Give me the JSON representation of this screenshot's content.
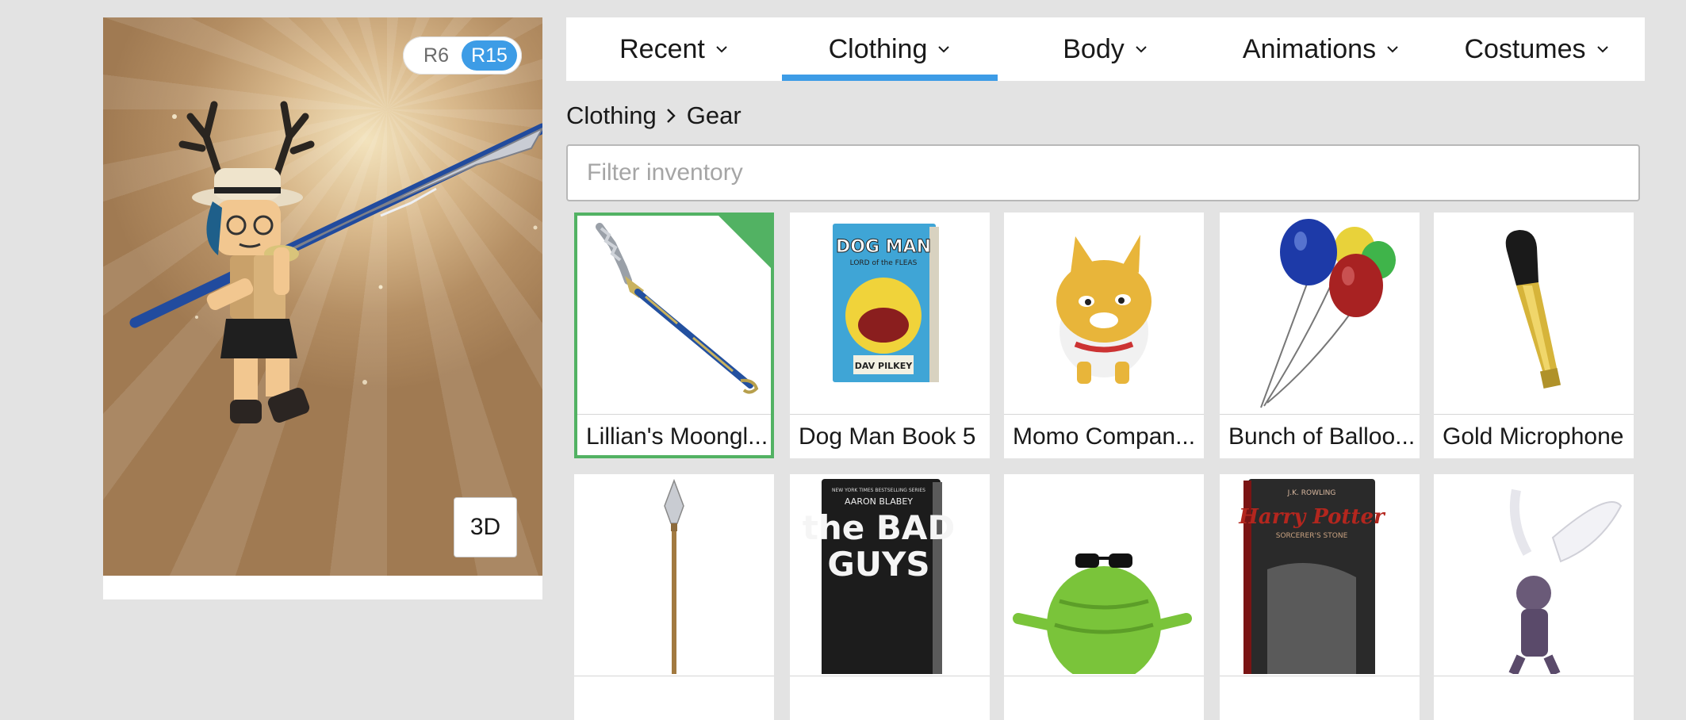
{
  "avatar": {
    "rig_options": [
      "R6",
      "R15"
    ],
    "selected_rig": "R15",
    "view_button_label": "3D"
  },
  "tabs": [
    {
      "label": "Recent",
      "active": false
    },
    {
      "label": "Clothing",
      "active": true
    },
    {
      "label": "Body",
      "active": false
    },
    {
      "label": "Animations",
      "active": false
    },
    {
      "label": "Costumes",
      "active": false
    }
  ],
  "breadcrumb": {
    "parent": "Clothing",
    "current": "Gear"
  },
  "filter": {
    "placeholder": "Filter inventory",
    "value": ""
  },
  "items": [
    {
      "name": "Lillian's Moongl...",
      "selected": true
    },
    {
      "name": "Dog Man Book 5",
      "selected": false
    },
    {
      "name": "Momo Compan...",
      "selected": false
    },
    {
      "name": "Bunch of Balloo...",
      "selected": false
    },
    {
      "name": "Gold Microphone",
      "selected": false
    },
    {
      "name": "",
      "selected": false
    },
    {
      "name": "",
      "selected": false
    },
    {
      "name": "",
      "selected": false
    },
    {
      "name": "",
      "selected": false
    },
    {
      "name": "",
      "selected": false
    }
  ],
  "book_covers": {
    "dog_man": {
      "title_line1": "DOG MAN",
      "subtitle": "LORD of the FLEAS",
      "author": "DAV PILKEY"
    },
    "bad_guys": {
      "series_banner": "NEW YORK TIMES BESTSELLING SERIES",
      "author": "AARON BLABEY",
      "title_line1": "the BAD",
      "title_line2": "GUYS"
    },
    "harry_potter": {
      "author": "J.K. ROWLING",
      "title_line1": "Harry Potter",
      "subtitle": "SORCERER'S STONE"
    }
  },
  "colors": {
    "accent": "#3d9ce6",
    "selected_border": "#52b263",
    "background": "#e3e3e3"
  }
}
